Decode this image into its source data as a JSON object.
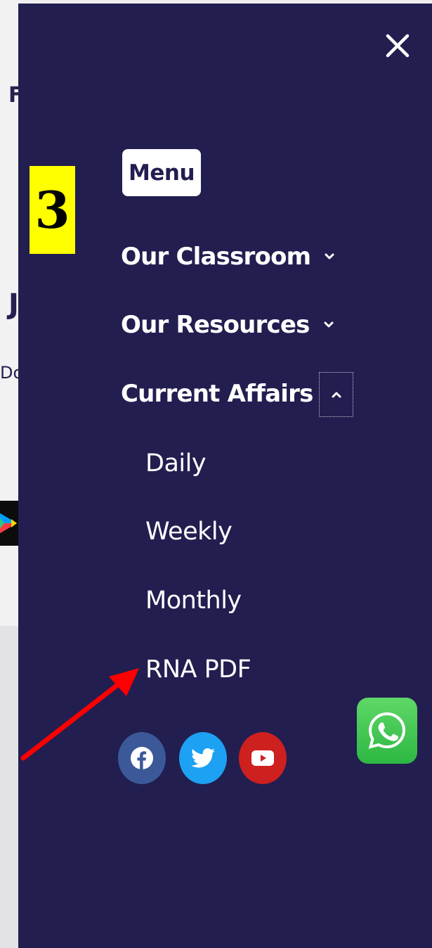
{
  "step_number": "3",
  "background_page": {
    "letters": [
      "F",
      "J",
      "Do"
    ]
  },
  "drawer": {
    "menu_label": "Menu",
    "nav_items": [
      {
        "label": "Our Classroom",
        "chevron": "chevron-down-icon"
      },
      {
        "label": "Our Resources",
        "chevron": "chevron-down-icon"
      },
      {
        "label": "Current Affairs",
        "chevron": "chevron-up-icon",
        "expanded": true
      }
    ],
    "sub_items": [
      "Daily",
      "Weekly",
      "Monthly",
      "RNA PDF"
    ],
    "social_icons": [
      {
        "name": "facebook-icon",
        "color": "#3b5998"
      },
      {
        "name": "twitter-icon",
        "color": "#1da1f2"
      },
      {
        "name": "youtube-icon",
        "color": "#cd201f"
      }
    ]
  },
  "colors": {
    "drawer_bg": "#221e50",
    "badge_bg": "#ffff00",
    "arrow": "#ff0000",
    "whatsapp": "#2db742"
  }
}
